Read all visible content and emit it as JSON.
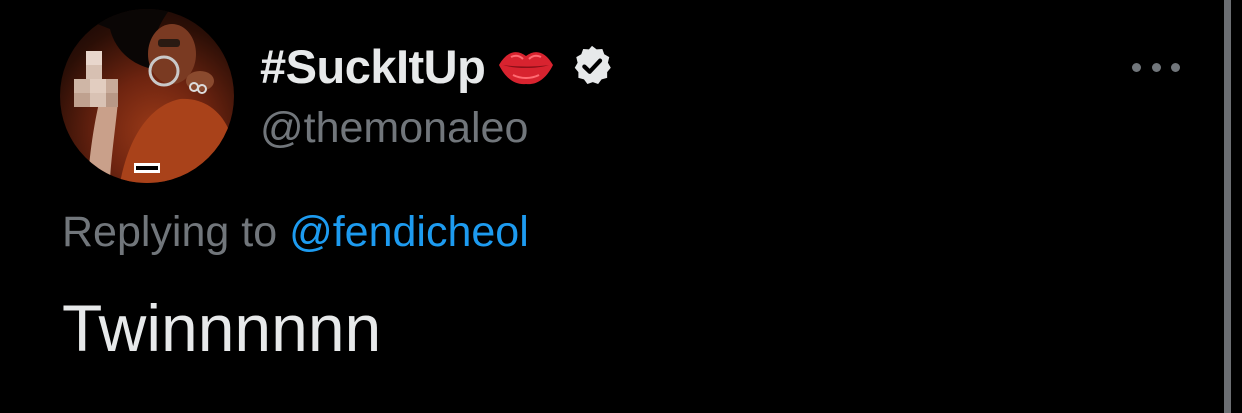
{
  "tweet": {
    "display_name": "#SuckItUp",
    "handle": "@themonaleo",
    "replying_prefix": "Replying to ",
    "replying_to": "@fendicheol",
    "text": "Twinnnnnn",
    "emoji_icon": "kiss-lips-icon",
    "verified_icon": "verified-badge-icon",
    "more_icon": "more-options-icon"
  },
  "colors": {
    "background": "#000000",
    "primary_text": "#e7e9ea",
    "secondary_text": "#71767b",
    "link": "#1d9bf0",
    "lips": "#d8232f"
  }
}
